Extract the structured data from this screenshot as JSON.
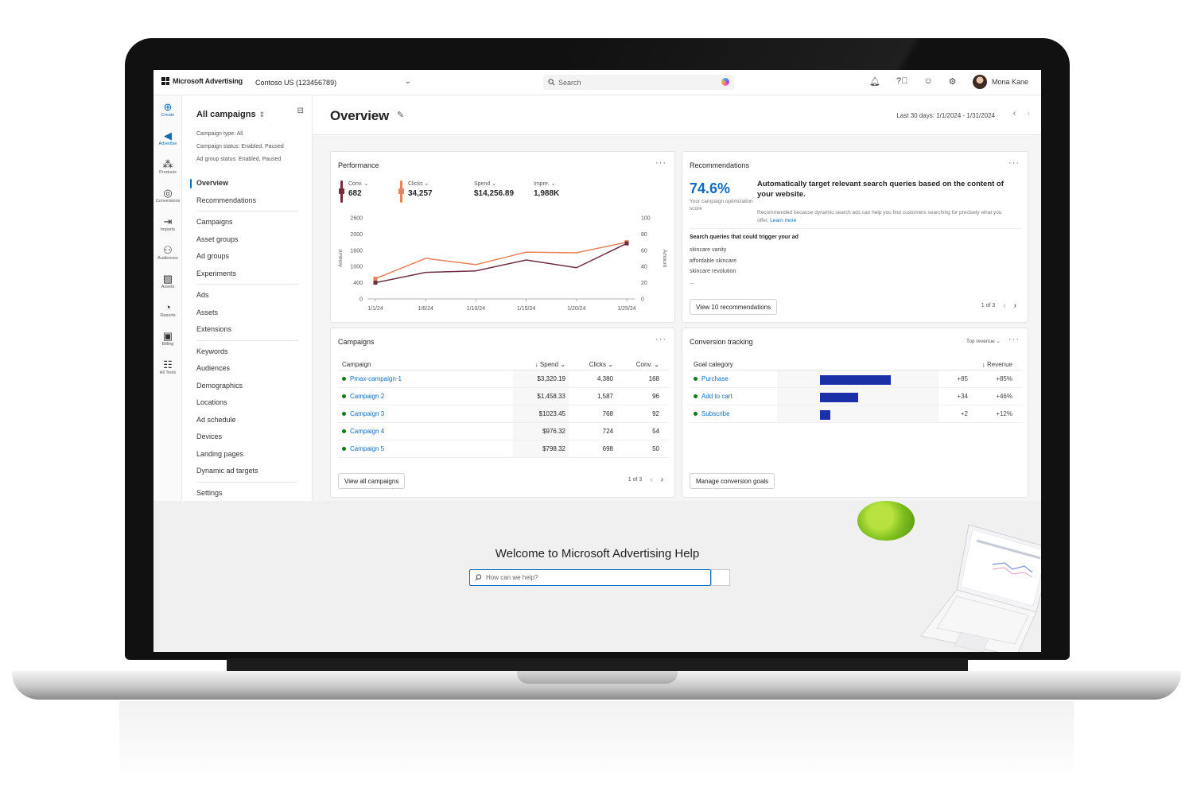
{
  "topbar": {
    "brand": "Microsoft Advertising",
    "account": "Contoso US (123456789)",
    "search_placeholder": "Search",
    "user_name": "Mona Kane"
  },
  "rail": {
    "items": [
      "Create",
      "Advertise",
      "Products",
      "Conversions",
      "Imports",
      "Audiences",
      "Assets",
      "Reports",
      "Billing",
      "All Tools"
    ]
  },
  "nav": {
    "scope_title": "All campaigns",
    "filters": [
      "Campaign type: All",
      "Campaign status: Enabled, Paused",
      "Ad group status: Enabled, Paused"
    ],
    "groups": [
      [
        "Overview",
        "Recommendations"
      ],
      [
        "Campaigns",
        "Asset groups",
        "Ad groups",
        "Experiments"
      ],
      [
        "Ads",
        "Assets",
        "Extensions"
      ],
      [
        "Keywords",
        "Audiences",
        "Demographics",
        "Locations",
        "Ad schedule",
        "Devices",
        "Landing pages",
        "Dynamic ad targets"
      ],
      [
        "Settings"
      ]
    ],
    "active": "Overview"
  },
  "overview": {
    "title": "Overview",
    "date_range": "Last 30 days: 1/1/2024 - 1/31/2024"
  },
  "performance": {
    "title": "Performance",
    "metrics": [
      {
        "name": "Conv.",
        "value": "682",
        "color": "#7b2a3a"
      },
      {
        "name": "Clicks",
        "value": "34,257",
        "color": "#e8825c"
      },
      {
        "name": "Spend",
        "value": "$14,256.89",
        "color": ""
      },
      {
        "name": "Impre.",
        "value": "1,988K",
        "color": ""
      }
    ]
  },
  "chart_data": {
    "type": "line",
    "x": [
      "1/1/24",
      "1/6/24",
      "1/10/24",
      "1/15/24",
      "1/20/24",
      "1/25/24"
    ],
    "ylabel": "Amount",
    "y2label": "Amount",
    "ylim": [
      0,
      2600
    ],
    "y_ticks": [
      "0",
      "400",
      "1000",
      "1600",
      "2000",
      "2600"
    ],
    "y2lim": [
      0,
      100
    ],
    "y2_ticks": [
      "0",
      "20",
      "40",
      "60",
      "80",
      "100"
    ],
    "series": [
      {
        "color": "#e8825c",
        "x_idx": [
          0,
          1,
          2,
          3,
          4,
          5
        ],
        "values": [
          650,
          1300,
          1100,
          1500,
          1480,
          1820
        ]
      },
      {
        "color": "#6e2c44",
        "x_idx": [
          0,
          1,
          2,
          3,
          4,
          5
        ],
        "values": [
          520,
          850,
          900,
          1250,
          1000,
          1780
        ]
      }
    ]
  },
  "recommendations": {
    "title": "Recommendations",
    "score": "74.6%",
    "score_label": "Your campaign optimization score",
    "headline": "Automatically target relevant search queries based on the content of your website.",
    "reason": "Recommended because dynamic search ads can help you find customers searching for precisely what you offer.",
    "learn_more": "Learn more",
    "queries_title": "Search queries that could trigger your ad",
    "queries": [
      "skincare vanity",
      "affordable skincare",
      "skincare revolution",
      "..."
    ],
    "button": "View 10 recommendations",
    "pager": "1 of 3"
  },
  "campaigns": {
    "title": "Campaigns",
    "headers": {
      "name": "Campaign",
      "spend": "Spend",
      "clicks": "Clicks",
      "conv": "Conv."
    },
    "rows": [
      {
        "name": "Pmax-campaign-1",
        "spend": "$3,320.19",
        "clicks": "4,380",
        "conv": "168"
      },
      {
        "name": "Campaign 2",
        "spend": "$1,458.33",
        "clicks": "1,587",
        "conv": "96"
      },
      {
        "name": "Campaign 3",
        "spend": "$1023.45",
        "clicks": "768",
        "conv": "92"
      },
      {
        "name": "Campaign 4",
        "spend": "$976.32",
        "clicks": "724",
        "conv": "54"
      },
      {
        "name": "Campaign 5",
        "spend": "$798.32",
        "clicks": "698",
        "conv": "50"
      }
    ],
    "button": "View all campaigns",
    "pager": "1 of 3"
  },
  "conversion": {
    "title": "Conversion tracking",
    "sort": "Top revenue",
    "headers": {
      "goal": "Goal category",
      "revenue": "Revenue"
    },
    "rows": [
      {
        "name": "Purchase",
        "share": 0.85,
        "delta": "+85",
        "pct": "+85%"
      },
      {
        "name": "Add to cart",
        "share": 0.46,
        "delta": "+34",
        "pct": "+46%"
      },
      {
        "name": "Subscribe",
        "share": 0.12,
        "delta": "+2",
        "pct": "+12%"
      }
    ],
    "button": "Manage conversion goals"
  },
  "help": {
    "title": "Welcome to Microsoft Advertising Help",
    "placeholder": "How can we help?"
  }
}
